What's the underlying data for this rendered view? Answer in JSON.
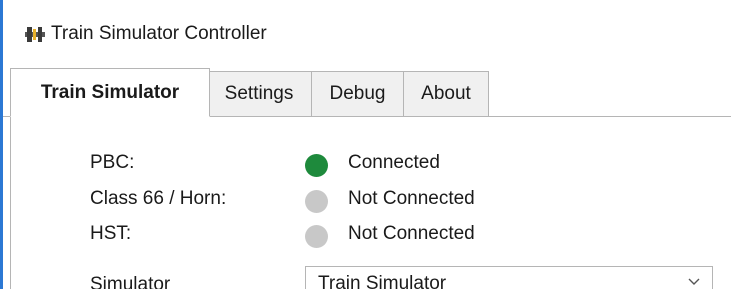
{
  "window": {
    "title": "Train Simulator Controller",
    "app_icon": "train-controller-icon"
  },
  "tabs": [
    {
      "label": "Train Simulator",
      "active": true
    },
    {
      "label": "Settings",
      "active": false
    },
    {
      "label": "Debug",
      "active": false
    },
    {
      "label": "About",
      "active": false
    }
  ],
  "connections": [
    {
      "label": "PBC:",
      "status": "Connected",
      "connected": true
    },
    {
      "label": "Class 66 / Horn:",
      "status": "Not Connected",
      "connected": false
    },
    {
      "label": "HST:",
      "status": "Not Connected",
      "connected": false
    }
  ],
  "simulator": {
    "label": "Simulator",
    "selected": "Train Simulator",
    "icon": "chevron-down-icon"
  },
  "colors": {
    "connected": "#1e8a3c",
    "not_connected": "#c8c8c8",
    "accent": "#2b78d4"
  }
}
